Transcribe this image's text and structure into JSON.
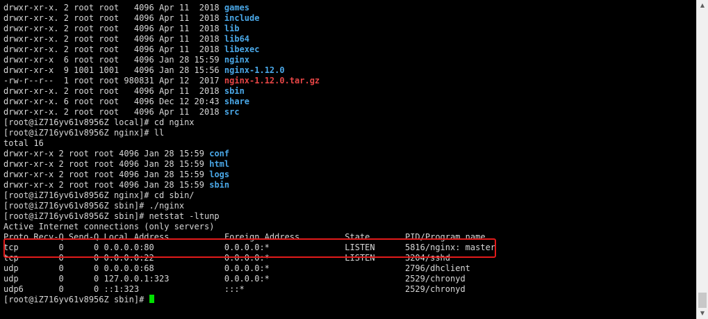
{
  "terminal": {
    "listing1": [
      {
        "prefix": "drwxr-xr-x. 2 root root   4096 Apr 11  2018 ",
        "name": "games",
        "kind": "dir"
      },
      {
        "prefix": "drwxr-xr-x. 2 root root   4096 Apr 11  2018 ",
        "name": "include",
        "kind": "dir"
      },
      {
        "prefix": "drwxr-xr-x. 2 root root   4096 Apr 11  2018 ",
        "name": "lib",
        "kind": "dir"
      },
      {
        "prefix": "drwxr-xr-x. 2 root root   4096 Apr 11  2018 ",
        "name": "lib64",
        "kind": "dir"
      },
      {
        "prefix": "drwxr-xr-x. 2 root root   4096 Apr 11  2018 ",
        "name": "libexec",
        "kind": "dir"
      },
      {
        "prefix": "drwxr-xr-x  6 root root   4096 Jan 28 15:59 ",
        "name": "nginx",
        "kind": "dir"
      },
      {
        "prefix": "drwxr-xr-x  9 1001 1001   4096 Jan 28 15:56 ",
        "name": "nginx-1.12.0",
        "kind": "dir"
      },
      {
        "prefix": "-rw-r--r--  1 root root 980831 Apr 12  2017 ",
        "name": "nginx-1.12.0.tar.gz",
        "kind": "archive"
      },
      {
        "prefix": "drwxr-xr-x. 2 root root   4096 Apr 11  2018 ",
        "name": "sbin",
        "kind": "dir"
      },
      {
        "prefix": "drwxr-xr-x. 6 root root   4096 Dec 12 20:43 ",
        "name": "share",
        "kind": "dir"
      },
      {
        "prefix": "drwxr-xr-x. 2 root root   4096 Apr 11  2018 ",
        "name": "src",
        "kind": "dir"
      }
    ],
    "cmd_cd_nginx": "[root@iZ716yv61v8956Z local]# cd nginx",
    "cmd_ll": "[root@iZ716yv61v8956Z nginx]# ll",
    "total": "total 16",
    "listing2": [
      {
        "prefix": "drwxr-xr-x 2 root root 4096 Jan 28 15:59 ",
        "name": "conf",
        "kind": "dir"
      },
      {
        "prefix": "drwxr-xr-x 2 root root 4096 Jan 28 15:59 ",
        "name": "html",
        "kind": "dir"
      },
      {
        "prefix": "drwxr-xr-x 2 root root 4096 Jan 28 15:59 ",
        "name": "logs",
        "kind": "dir"
      },
      {
        "prefix": "drwxr-xr-x 2 root root 4096 Jan 28 15:59 ",
        "name": "sbin",
        "kind": "dir"
      }
    ],
    "cmd_cd_sbin": "[root@iZ716yv61v8956Z nginx]# cd sbin/",
    "cmd_run_nginx": "[root@iZ716yv61v8956Z sbin]# ./nginx",
    "cmd_netstat": "[root@iZ716yv61v8956Z sbin]# netstat -ltunp",
    "netstat_title": "Active Internet connections (only servers)",
    "netstat_header": "Proto Recv-Q Send-Q Local Address           Foreign Address         State       PID/Program name",
    "netstat_rows": [
      "tcp        0      0 0.0.0.0:80              0.0.0.0:*               LISTEN      5816/nginx: master",
      "tcp        0      0 0.0.0.0:22              0.0.0.0:*               LISTEN      3204/sshd",
      "udp        0      0 0.0.0.0:68              0.0.0.0:*                           2796/dhclient",
      "udp        0      0 127.0.0.1:323           0.0.0.0:*                           2529/chronyd",
      "udp6       0      0 ::1:323                 :::*                                2529/chronyd"
    ],
    "prompt": "[root@iZ716yv61v8956Z sbin]# "
  },
  "colors": {
    "background": "#000000",
    "text": "#d8d8d8",
    "directory": "#4aa8e8",
    "archive": "#e64545",
    "cursor": "#00e000",
    "highlight_box": "#e31b1b"
  },
  "scrollbar": {
    "up_icon": "▲",
    "down_icon": "▼"
  }
}
